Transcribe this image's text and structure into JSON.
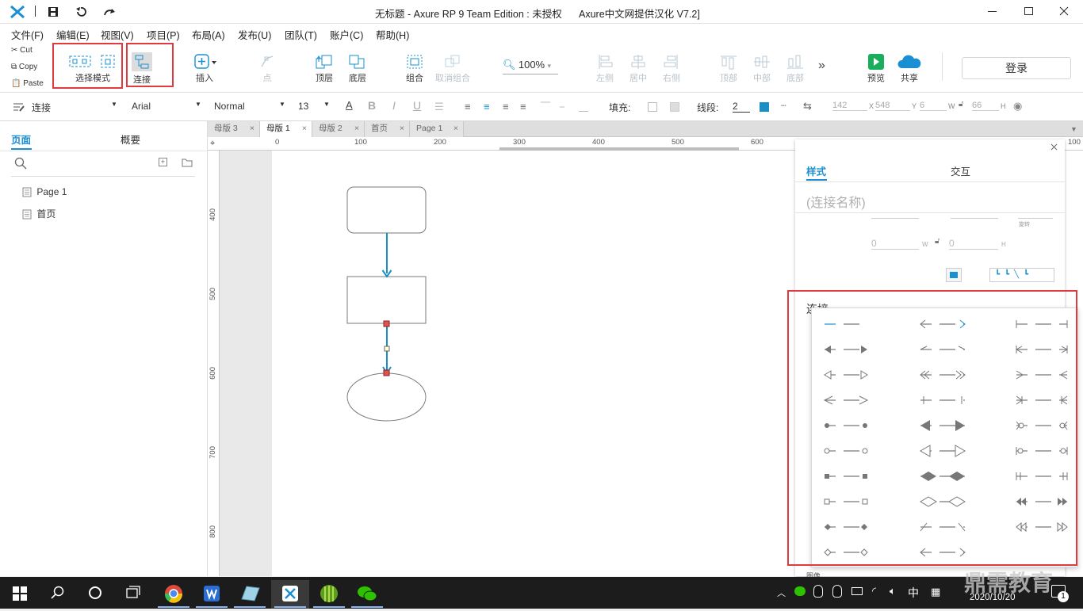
{
  "window": {
    "title": "无标题 - Axure RP 9 Team Edition : 未授权",
    "subtitle": "Axure中文网提供汉化 V7.2]"
  },
  "menu": [
    "文件(F)",
    "编辑(E)",
    "视图(V)",
    "项目(P)",
    "布局(A)",
    "发布(U)",
    "团队(T)",
    "账户(C)",
    "帮助(H)"
  ],
  "clipboard": {
    "cut": "Cut",
    "copy": "Copy",
    "paste": "Paste"
  },
  "toolbar": {
    "select_mode": "选择模式",
    "connect": "连接",
    "insert": "插入",
    "point": "点",
    "top_layer": "顶层",
    "bottom_layer": "底层",
    "group": "组合",
    "ungroup": "取消组合",
    "zoom": "100%",
    "align_left": "左侧",
    "align_center": "居中",
    "align_right": "右侧",
    "align_top": "顶部",
    "align_middle": "中部",
    "align_bottom": "底部",
    "preview": "预览",
    "share": "共享",
    "login": "登录"
  },
  "stylebar": {
    "style_name": "连接",
    "font": "Arial",
    "weight": "Normal",
    "size": "13",
    "fill_label": "填充:",
    "line_label": "线段:",
    "line_width": "2",
    "x": "142",
    "x_label": "X",
    "y": "548",
    "y_label": "Y",
    "w": "6",
    "w_label": "W",
    "h": "66",
    "h_label": "H"
  },
  "left_panel": {
    "tab_pages": "页面",
    "tab_outline": "概要",
    "pages": [
      "Page 1",
      "首页"
    ]
  },
  "tabs": [
    "母版 3",
    "母版 1",
    "母版 2",
    "首页",
    "Page 1"
  ],
  "ruler": {
    "h": [
      "0",
      "100",
      "200",
      "300",
      "400",
      "500",
      "600",
      "100"
    ],
    "v": [
      "400",
      "500",
      "600",
      "700",
      "800"
    ]
  },
  "right_panel": {
    "tab_style": "样式",
    "tab_interact": "交互",
    "name_placeholder": "(连接名称)",
    "w_value": "0",
    "w_label": "W",
    "h_value": "0",
    "h_label": "H",
    "rotate_label": "旋转",
    "section_title": "连接",
    "image_label": "图像"
  },
  "taskbar": {
    "clock": "2020/10/20",
    "ime": "中",
    "notif": "1",
    "watermark": "鼎需教育"
  },
  "colors": {
    "accent": "#1a8fd1",
    "red": "#e0393e",
    "connector": "#1a8fc4"
  }
}
